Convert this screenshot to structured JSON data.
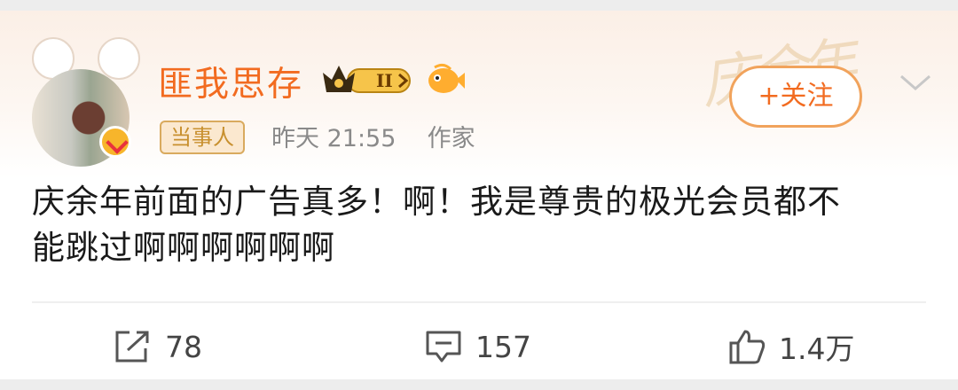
{
  "post": {
    "author": {
      "name": "匪我思存",
      "level": "II",
      "badge": "当事人",
      "time": "昨天 21:55",
      "identity": "作家"
    },
    "follow_label": "+关注",
    "content_line1": "庆余年前面的广告真多！啊！我是尊贵的极光会员都不",
    "content_line2": "能跳过啊啊啊啊啊啊",
    "actions": {
      "share_count": "78",
      "comment_count": "157",
      "like_count": "1.4万"
    }
  },
  "colors": {
    "name": "#f26b20",
    "follow_border": "#f1a35c",
    "tag_text": "#c8902f",
    "meta": "#8a8a8a"
  },
  "icons": [
    "crown-icon",
    "fish-icon",
    "verified-icon",
    "chevron-down-icon",
    "share-icon",
    "comment-icon",
    "like-icon"
  ]
}
